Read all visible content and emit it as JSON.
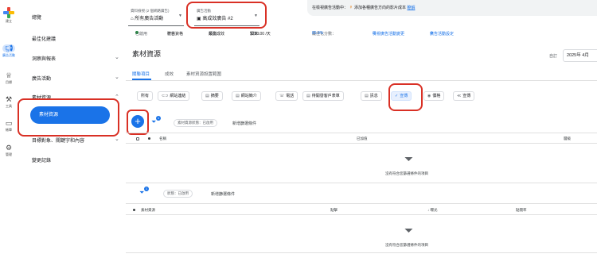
{
  "rail": {
    "items": [
      {
        "label": "建立",
        "icon": "plus-icon"
      },
      {
        "label": "廣告活動",
        "icon": "megaphone-icon"
      },
      {
        "label": "目標",
        "icon": "trophy-icon"
      },
      {
        "label": "工具",
        "icon": "tools-icon"
      },
      {
        "label": "帳單",
        "icon": "credit-card-icon"
      },
      {
        "label": "管理",
        "icon": "gear-icon"
      }
    ]
  },
  "nav": {
    "items": [
      "總覽",
      "最佳化建議",
      "洞察與報表",
      "廣告活動",
      "素材資源",
      "目標對象、關鍵字和內容",
      "變更記錄"
    ],
    "selected": "素材資源"
  },
  "topbar": {
    "account_label": "資料檢視 (2 個網路廣告)",
    "account_value": "所有廣告活動",
    "campaign_label": "廣告活動",
    "campaign_value": "高成效廣告 #2",
    "notice_text": "在檢視廣告活動中：",
    "notice_msg": "添加各種廣告方向的影片成本",
    "notice_link": "瞭解"
  },
  "status": {
    "state": "已啟用",
    "status_label": "狀態：",
    "status_value": "符合資格",
    "type_label": "類型：",
    "type_value": "最高成效",
    "budget_label": "預算：",
    "budget_value": "$230.00 /天",
    "opt_label": "最佳化分數：",
    "opt_value": "85.9%",
    "link1": "檢視廣告活動變更",
    "link2": "廣告活動設定"
  },
  "page": {
    "title": "素材資源",
    "date_label": "自訂",
    "date_value": "2025年 4月"
  },
  "tabs": [
    "關聯項目",
    "成效",
    "素材資源設置範圍"
  ],
  "chips": [
    {
      "label": "所有",
      "icon": ""
    },
    {
      "label": "網站連結",
      "icon": "link-icon"
    },
    {
      "label": "摘要",
      "icon": "snippet-icon"
    },
    {
      "label": "網站簡介",
      "icon": "sitelink-icon"
    },
    {
      "label": "電話",
      "icon": "phone-icon"
    },
    {
      "label": "待開發客戶表單",
      "icon": "form-icon"
    },
    {
      "label": "訊息",
      "icon": "message-icon"
    },
    {
      "label": "宣傳",
      "icon": "promotion-icon",
      "selected": true
    },
    {
      "label": "價格",
      "icon": "price-icon"
    },
    {
      "label": "宣傳",
      "icon": "callout-icon"
    }
  ],
  "filter1": {
    "chip": "素材資源狀態：已啟用",
    "add": "新增篩選條件",
    "badge": "1"
  },
  "table1": {
    "columns": [
      "名稱",
      "已加值",
      "層級"
    ],
    "empty": "沒有符合您篩選條件的項目"
  },
  "filter2": {
    "chip": "狀態：已啟用",
    "add": "新增篩選條件",
    "badge": "1"
  },
  "table2": {
    "columns": [
      "素材資源",
      "點擊",
      "↓ 曝光",
      "點閱率"
    ],
    "empty": "沒有符合您篩選條件的項目"
  }
}
